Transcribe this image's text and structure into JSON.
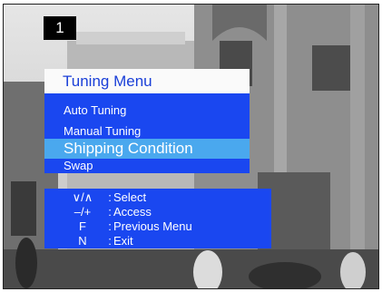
{
  "channel": {
    "number": "1"
  },
  "menu": {
    "title": "Tuning Menu",
    "items": [
      {
        "label": "Auto Tuning"
      },
      {
        "label": "Manual Tuning"
      },
      {
        "label": "Shipping Condition"
      },
      {
        "label": "Swap"
      }
    ],
    "selected_item": "Shipping Condition"
  },
  "help": [
    {
      "key": "∨/∧",
      "sep": ":",
      "label": "Select"
    },
    {
      "key": "–/+",
      "sep": ":",
      "label": "Access"
    },
    {
      "key": "F",
      "sep": ":",
      "label": "Previous Menu"
    },
    {
      "key": "N",
      "sep": ":",
      "label": "Exit"
    }
  ],
  "colors": {
    "menu_blue": "#1a47f0",
    "highlight": "#4aa8ee",
    "title_text": "#1a3fd8"
  }
}
